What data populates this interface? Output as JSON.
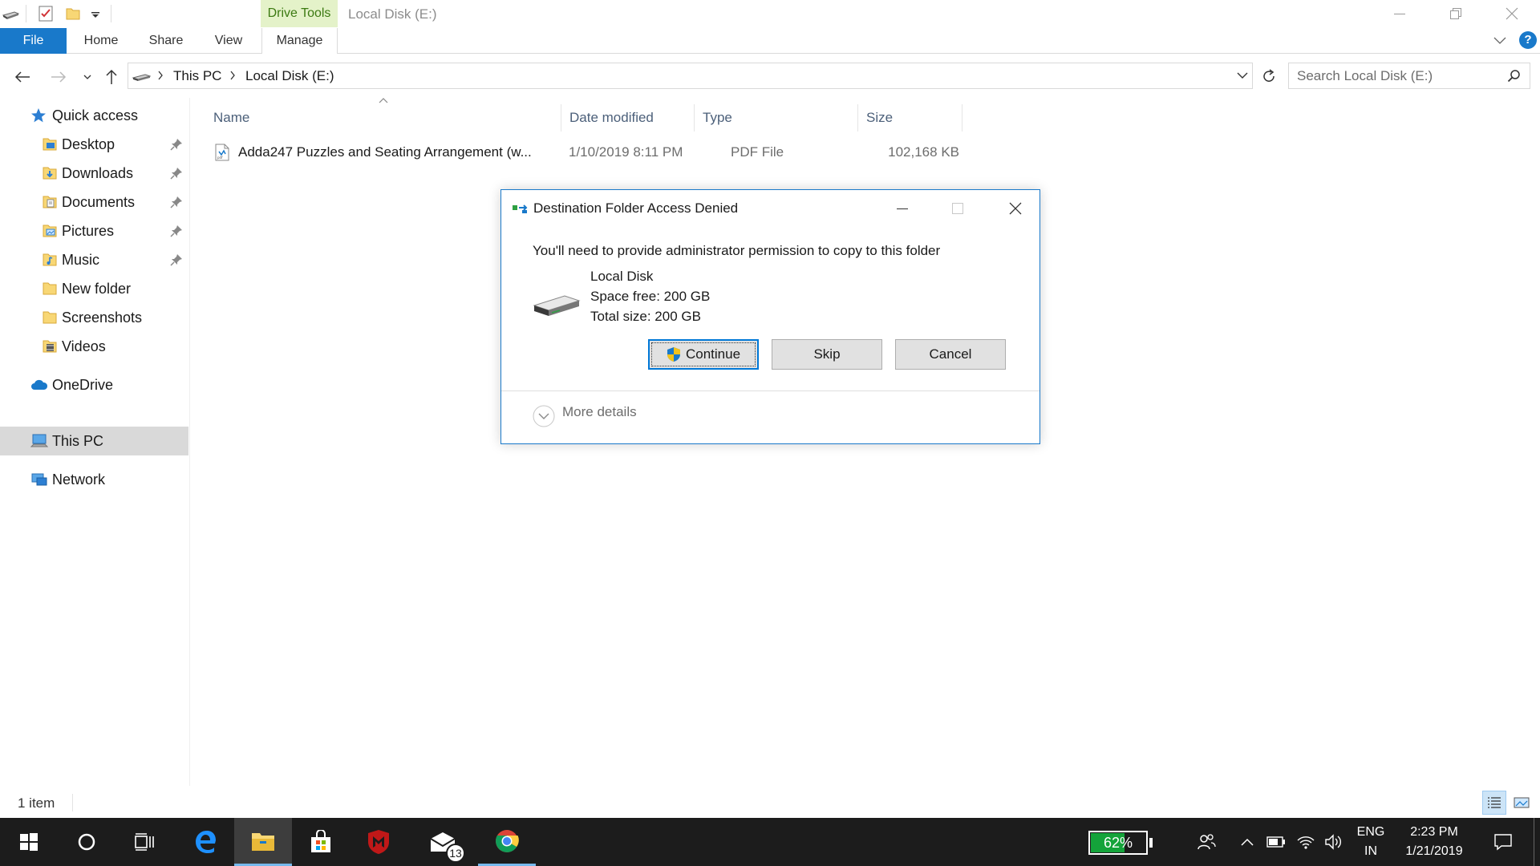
{
  "titlebar": {
    "context_tab": "Drive Tools",
    "window_title": "Local Disk (E:)"
  },
  "ribbon": {
    "tabs": [
      "File",
      "Home",
      "Share",
      "View",
      "Manage"
    ]
  },
  "address": {
    "breadcrumb": [
      "This PC",
      "Local Disk (E:)"
    ],
    "search_placeholder": "Search Local Disk (E:)"
  },
  "nav_pane": {
    "quick_access": "Quick access",
    "pinned": [
      "Desktop",
      "Downloads",
      "Documents",
      "Pictures",
      "Music"
    ],
    "folders": [
      "New folder",
      "Screenshots",
      "Videos"
    ],
    "onedrive": "OneDrive",
    "this_pc": "This PC",
    "network": "Network"
  },
  "columns": {
    "name": "Name",
    "date_modified": "Date modified",
    "type": "Type",
    "size": "Size"
  },
  "files": [
    {
      "name": "Adda247 Puzzles and Seating Arrangement (w...",
      "date_modified": "1/10/2019 8:11 PM",
      "type": "PDF File",
      "size": "102,168 KB"
    }
  ],
  "status": {
    "item_count": "1 item"
  },
  "dialog": {
    "title": "Destination Folder Access Denied",
    "message": "You'll need to provide administrator permission to copy to this folder",
    "drive_name": "Local Disk",
    "space_free": "Space free: 200 GB",
    "total_size": "Total size: 200 GB",
    "buttons": {
      "continue": "Continue",
      "skip": "Skip",
      "cancel": "Cancel"
    },
    "more_details": "More details"
  },
  "taskbar": {
    "mail_badge": "13",
    "battery": "62%",
    "battery_level": 0.62,
    "language": "ENG",
    "region": "IN",
    "time": "2:23 PM",
    "date": "1/21/2019"
  },
  "colors": {
    "accent": "#1979ca",
    "drive_tools_bg": "#e4f2c9",
    "selection": "#d9d9d9",
    "taskbar": "#1c1c1c",
    "battery_green": "#14a33a"
  }
}
